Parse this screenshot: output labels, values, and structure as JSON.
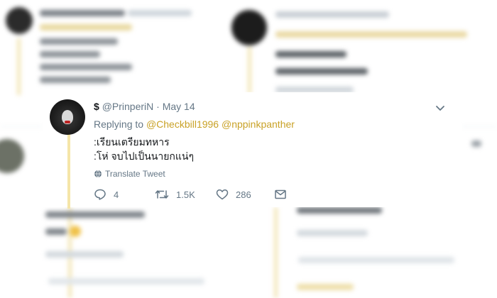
{
  "tweet": {
    "name": "$",
    "handle": "@PrinperiN",
    "separator": "·",
    "date": "May 14",
    "replying_prefix": "Replying to",
    "mentions": [
      "@Checkbill1996",
      "@nppinkpanther"
    ],
    "lines": [
      ":เรียนเตรียมทหาร",
      ":โห่ จบไปเป็นนายกแน่ๆ"
    ],
    "translate_label": "Translate Tweet",
    "reply_count": "4",
    "retweet_count": "1.5K",
    "like_count": "286"
  },
  "colors": {
    "mention": "#c9a227",
    "thread_line": "#f5e5a8",
    "muted": "#657786"
  },
  "icons": [
    "chevron-down-icon",
    "globe-icon",
    "reply-icon",
    "retweet-icon",
    "like-icon",
    "message-icon"
  ]
}
